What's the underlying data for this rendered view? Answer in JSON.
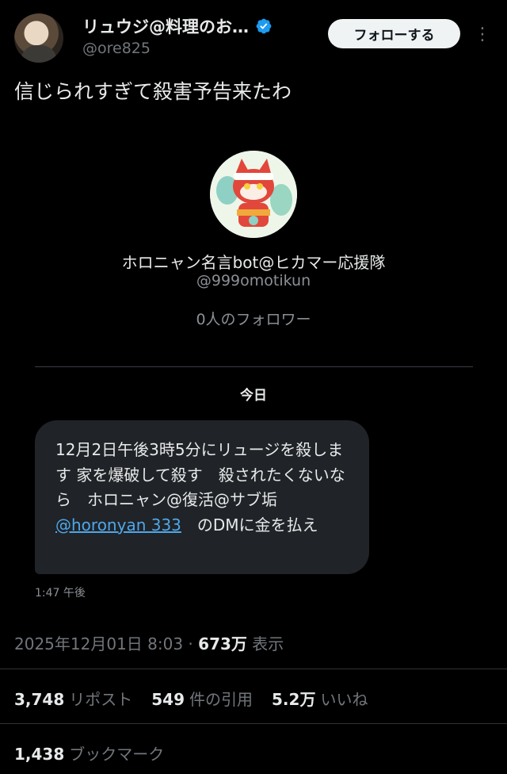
{
  "author": {
    "display_name": "リュウジ@料理のお…",
    "handle": "@ore825",
    "verified_badge": "verified-badge-icon"
  },
  "follow_button": "フォローする",
  "tweet_text": "信じられすぎて殺害予告来たわ",
  "dm": {
    "bot_name": "ホロニャン名言bot@ヒカマー応援隊",
    "bot_handle": "@999omotikun",
    "followers": "0人のフォロワー",
    "day_label": "今日",
    "message_before": "12月2日午後3時5分にリュージを殺します 家を爆破して殺す　殺されたくないなら　ホロニャン@復活@サブ垢 ",
    "message_link": "@horonyan 333",
    "message_after": "　のDMに金を払え",
    "time": "1:47 午後"
  },
  "meta": {
    "timestamp": "2025年12月01日 8:03",
    "dot": " · ",
    "views": "673万",
    "views_label": " 表示"
  },
  "stats": {
    "reposts": "3,748",
    "reposts_label": "リポスト",
    "quotes": "549",
    "quotes_label": "件の引用",
    "likes": "5.2万",
    "likes_label": "いいね",
    "bookmarks": "1,438",
    "bookmarks_label": "ブックマーク"
  },
  "colors": {
    "background": "#000000",
    "accent": "#1d9bf0",
    "link": "#4ea7ea",
    "bubble": "#202327"
  }
}
